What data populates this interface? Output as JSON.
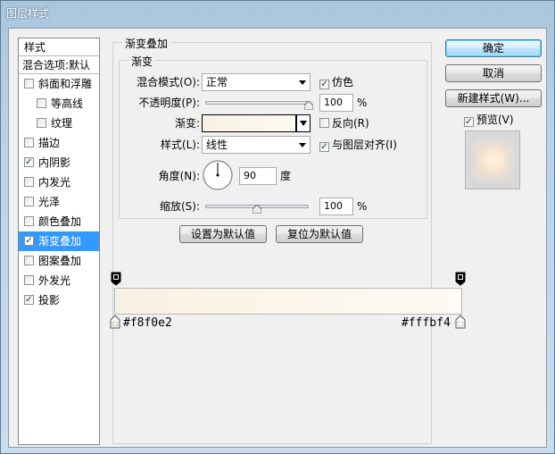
{
  "window": {
    "title": "图层样式"
  },
  "sidebar": {
    "header": "样式",
    "blend_options": "混合选项:默认",
    "items": [
      {
        "label": "斜面和浮雕",
        "checked": false,
        "sub": false
      },
      {
        "label": "等高线",
        "checked": false,
        "sub": true
      },
      {
        "label": "纹理",
        "checked": false,
        "sub": true
      },
      {
        "label": "描边",
        "checked": false,
        "sub": false
      },
      {
        "label": "内阴影",
        "checked": true,
        "sub": false
      },
      {
        "label": "内发光",
        "checked": false,
        "sub": false
      },
      {
        "label": "光泽",
        "checked": false,
        "sub": false
      },
      {
        "label": "颜色叠加",
        "checked": false,
        "sub": false
      },
      {
        "label": "渐变叠加",
        "checked": true,
        "sub": false,
        "selected": true
      },
      {
        "label": "图案叠加",
        "checked": false,
        "sub": false
      },
      {
        "label": "外发光",
        "checked": false,
        "sub": false
      },
      {
        "label": "投影",
        "checked": true,
        "sub": false
      }
    ]
  },
  "panel": {
    "group_title": "渐变叠加",
    "subgroup_title": "渐变",
    "blend_mode_label": "混合模式(O):",
    "blend_mode_value": "正常",
    "dither_label": "仿色",
    "dither_checked": true,
    "opacity_label": "不透明度(P):",
    "opacity_value": "100",
    "opacity_unit": "%",
    "opacity_level": 1.0,
    "gradient_label": "渐变:",
    "reverse_label": "反向(R)",
    "reverse_checked": false,
    "style_label": "样式(L):",
    "style_value": "线性",
    "align_label": "与图层对齐(I)",
    "align_checked": true,
    "angle_label": "角度(N):",
    "angle_value": "90",
    "angle_unit": "度",
    "scale_label": "缩放(S):",
    "scale_value": "100",
    "scale_unit": "%",
    "scale_level": 0.5,
    "make_default": "设置为默认值",
    "reset_default": "复位为默认值"
  },
  "gradient_bar": {
    "left_color_label": "#f8f0e2",
    "right_color_label": "#fffbf4",
    "left_color": "#f8f0e2",
    "right_color": "#fffbf4"
  },
  "buttons": {
    "ok": "确定",
    "cancel": "取消",
    "new_style": "新建样式(W)...",
    "preview_label": "预览(V)",
    "preview_checked": true
  }
}
